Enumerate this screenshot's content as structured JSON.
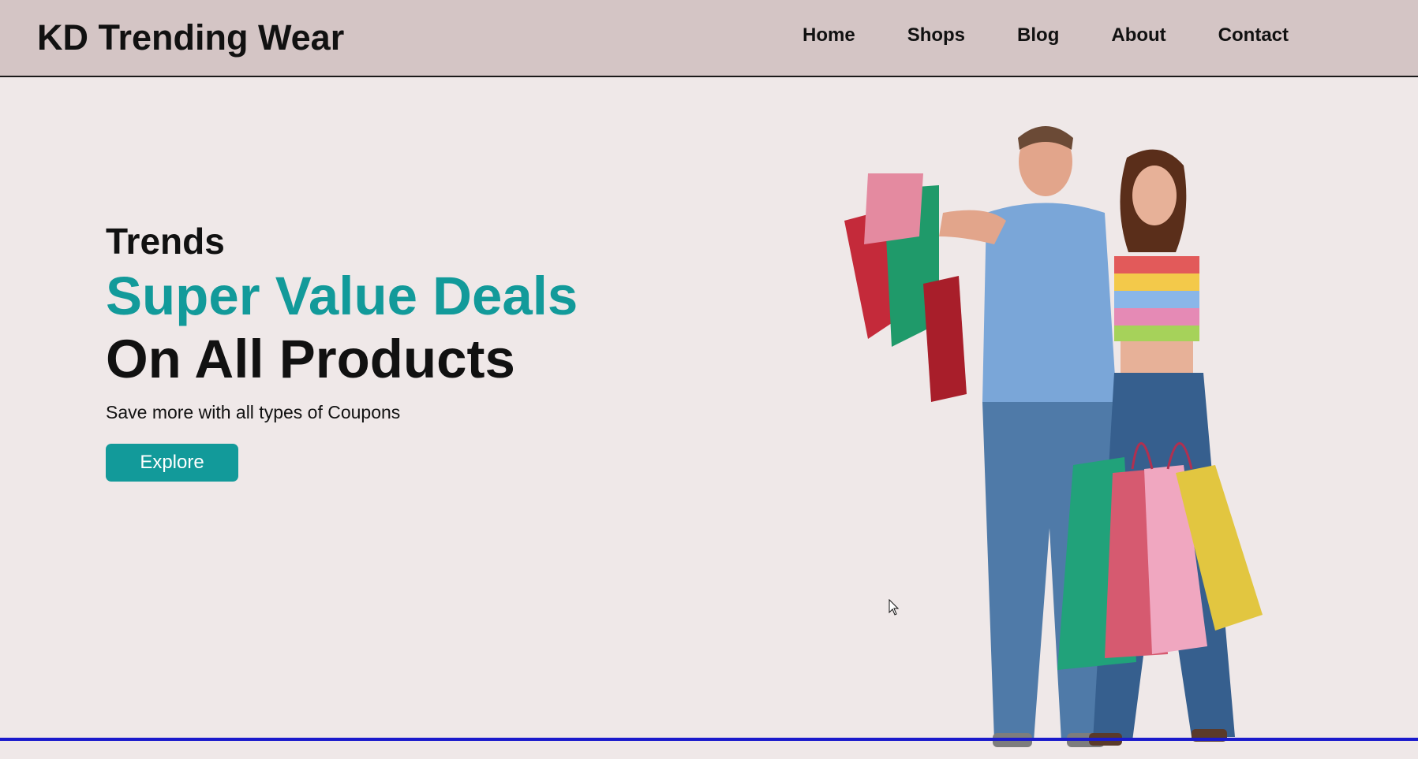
{
  "header": {
    "brand": "KD Trending Wear",
    "nav": [
      "Home",
      "Shops",
      "Blog",
      "About",
      "Contact"
    ]
  },
  "hero": {
    "eyebrow": "Trends",
    "headline_1": "Super Value Deals",
    "headline_2": "On All Products",
    "subtitle": "Save more with all types of Coupons",
    "cta_label": "Explore"
  },
  "colors": {
    "header_bg": "#d4c5c5",
    "page_bg": "#efe8e8",
    "accent": "#129a9a",
    "bottom_line": "#1a1acc"
  }
}
